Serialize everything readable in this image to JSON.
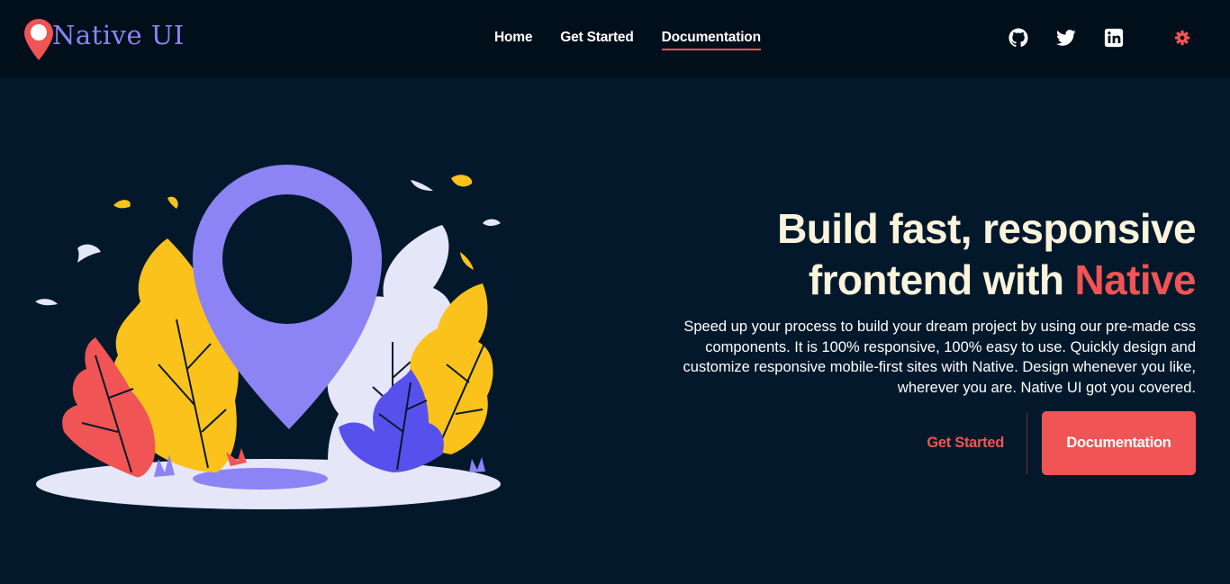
{
  "brand": {
    "name": "Native UI"
  },
  "nav": {
    "links": [
      {
        "label": "Home"
      },
      {
        "label": "Get Started"
      },
      {
        "label": "Documentation",
        "active": true
      }
    ],
    "icons": [
      "github-icon",
      "twitter-icon",
      "linkedin-icon",
      "settings-gear-icon"
    ]
  },
  "hero": {
    "title_line1": "Build fast, responsive",
    "title_line2_prefix": "frontend with ",
    "title_line2_accent": "Native",
    "description": "Speed up your process to build your dream project by using our pre-made css components. It is 100% responsive, 100% easy to use. Quickly design and customize responsive mobile-first sites with Native. Design whenever you like, wherever you are. Native UI got you covered.",
    "secondary_cta": "Get Started",
    "primary_cta": "Documentation"
  },
  "colors": {
    "background": "#03192b",
    "navbar": "#010f1b",
    "accent": "#f05454",
    "brand_purple": "#8c83f5",
    "title_text": "#faf4dc",
    "leaf_yellow": "#fbc21b",
    "leaf_blue": "#5850ec",
    "leaf_light": "#e5e6f8"
  }
}
